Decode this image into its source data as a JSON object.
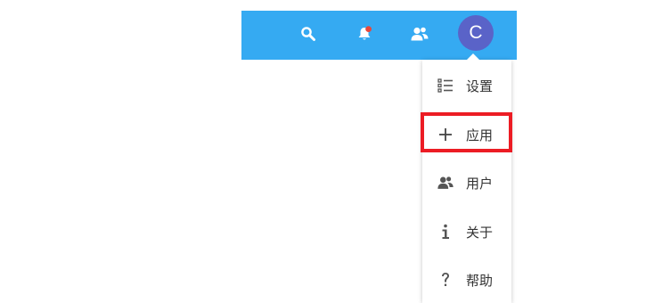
{
  "header": {
    "background_color": "#35aaf2",
    "icons": [
      {
        "name": "search-icon"
      },
      {
        "name": "notification-bell-icon",
        "badge_color": "#e8473b"
      },
      {
        "name": "contacts-icon"
      }
    ],
    "avatar": {
      "initial": "C",
      "background_color": "#5a63c8"
    }
  },
  "menu": {
    "items": [
      {
        "icon": "settings-list-icon",
        "label": "设置"
      },
      {
        "icon": "plus-icon",
        "label": "应用"
      },
      {
        "icon": "users-icon",
        "label": "用户"
      },
      {
        "icon": "info-icon",
        "label": "关于"
      },
      {
        "icon": "help-question-icon",
        "label": "帮助"
      }
    ]
  },
  "highlight": {
    "target": "应用",
    "color": "#ec1c24"
  }
}
